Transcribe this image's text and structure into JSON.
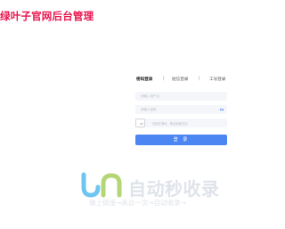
{
  "brand": {
    "title": "绿叶子官网后台管理",
    "color": "#e8164f"
  },
  "login": {
    "tabs": [
      {
        "label": "密码登录",
        "active": true
      },
      {
        "label": "短信登录",
        "active": false
      },
      {
        "label": "工号登录",
        "active": false
      }
    ],
    "username": {
      "value": "",
      "placeholder": "请输入用户名"
    },
    "password": {
      "value": "",
      "placeholder": "请输入密码"
    },
    "captcha": {
      "hint": "请按住滑块，拖动到最右边"
    },
    "submit_label": "登 录",
    "accent_color": "#4b86f2"
  },
  "watermark": {
    "title": "自动秒收录",
    "subtitle": "做上链接→来访一次→自动收录→"
  }
}
